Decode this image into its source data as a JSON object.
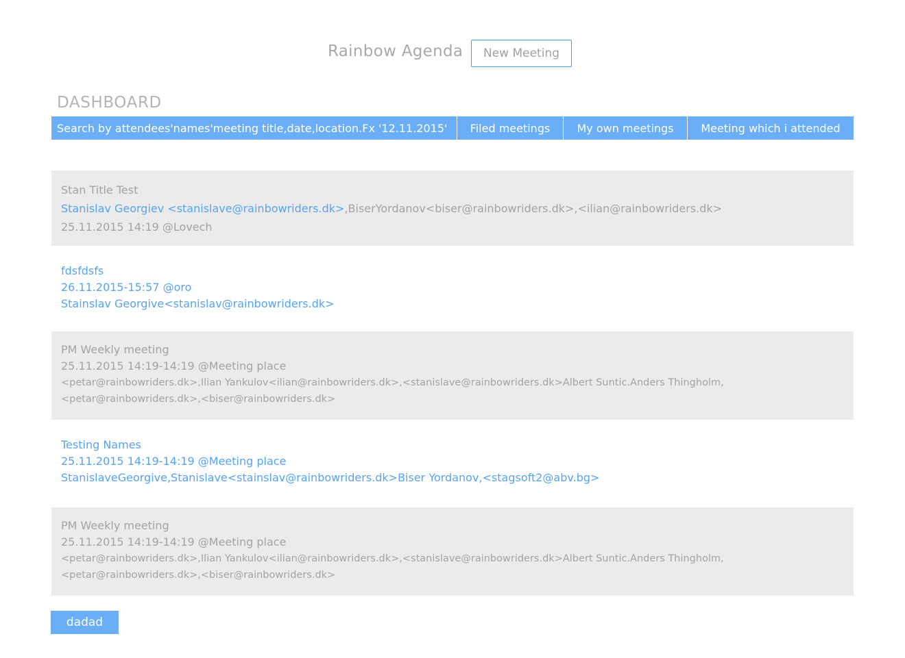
{
  "header": {
    "app_title": "Rainbow Agenda",
    "new_meeting_label": "New Meeting"
  },
  "dashboard": {
    "title": "DASHBOARD",
    "search_placeholder": "Search by attendees'names'meeting title,date,location.Fx '12.11.2015'",
    "tabs": [
      {
        "label": "Filed meetings"
      },
      {
        "label": "My own meetings"
      },
      {
        "label": "Meeting which i attended"
      }
    ]
  },
  "meetings": [
    {
      "title": "Stan Title Test",
      "attendees_highlight": "Stanislav Georgiev <stanislave@rainbowriders.dk>",
      "attendees_rest": ",BiserYordanov<biser@rainbowriders.dk>,<ilian@rainbowriders.dk>",
      "when_where": "25.11.2015 14:19 @Lovech"
    },
    {
      "title": "fdsfdsfs",
      "when_where": "26.11.2015-15:57 @oro",
      "attendees": "Stainslav Georgive<stanislav@rainbowriders.dk>"
    },
    {
      "title": "PM Weekly meeting",
      "when_where": "25.11.2015 14:19-14:19 @Meeting place",
      "attendees_line1": "<petar@rainbowriders.dk>,Ilian Yankulov<ilian@rainbowriders.dk>,<stanislave@rainbowriders.dk>Albert Suntic.Anders Thingholm,",
      "attendees_line2": "<petar@rainbowriders.dk>,<biser@rainbowriders.dk>"
    },
    {
      "title": "Testing Names",
      "when_where": "25.11.2015 14:19-14:19 @Meeting place",
      "attendees": "StanislaveGeorgive,Stanislave<stainslav@rainbowriders.dk>Biser Yordanov,<stagsoft2@abv.bg>"
    },
    {
      "title": "PM Weekly meeting",
      "when_where": "25.11.2015 14:19-14:19 @Meeting place",
      "attendees_line1": "<petar@rainbowriders.dk>,Ilian Yankulov<ilian@rainbowriders.dk>,<stanislave@rainbowriders.dk>Albert Suntic.Anders Thingholm,",
      "attendees_line2": "<petar@rainbowriders.dk>,<biser@rainbowriders.dk>"
    }
  ],
  "footer": {
    "button_label": "dadad"
  },
  "colors": {
    "accent": "#6aaef8",
    "link_blue": "#56a3f4",
    "muted_text": "#a3a3a3",
    "row_grey": "#ebebeb",
    "button_border": "#3f9be8"
  }
}
